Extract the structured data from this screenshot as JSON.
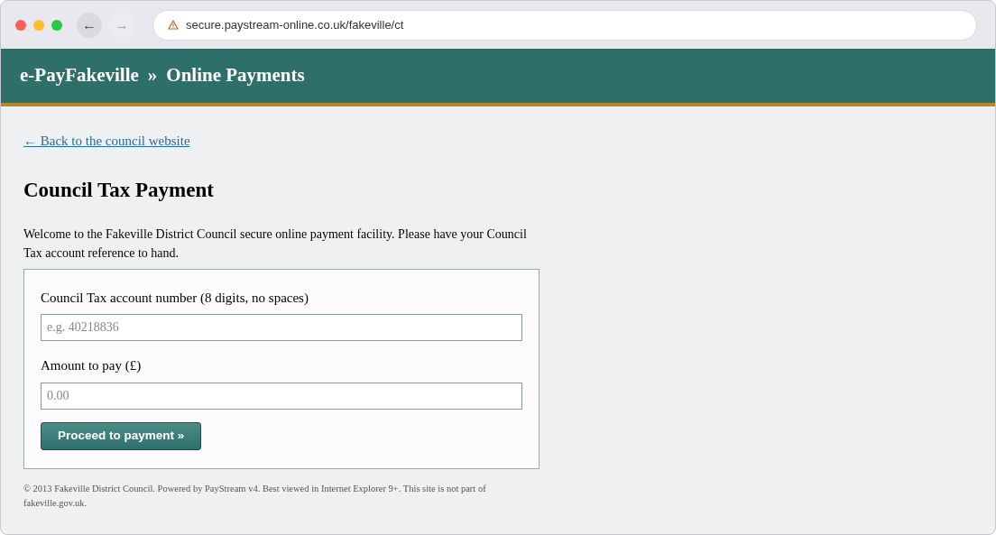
{
  "browser": {
    "nav_buttons": [
      {
        "label": "←",
        "disabled": false
      },
      {
        "label": "→",
        "disabled": true
      }
    ],
    "address": "secure.paystream-online.co.uk/fakeville/ct",
    "insecure": true
  },
  "header": {
    "site": "e-PayFakeville",
    "separator": "»",
    "section": "Online Payments"
  },
  "back_link": "← Back to the council website",
  "title": "Council Tax Payment",
  "intro": "Welcome to the Fakeville District Council secure online payment facility. Please have your Council Tax account reference to hand.",
  "form": {
    "fields": [
      {
        "label": "Council Tax account number (8 digits, no spaces)",
        "placeholder": "e.g. 40218836"
      },
      {
        "label": "Amount to pay (£)",
        "placeholder": "0.00"
      }
    ],
    "submit": "Proceed to payment »"
  },
  "footer": "© 2013 Fakeville District Council. Powered by PayStream v4. Best viewed in Internet Explorer 9+. This site is not part of fakeville.gov.uk."
}
